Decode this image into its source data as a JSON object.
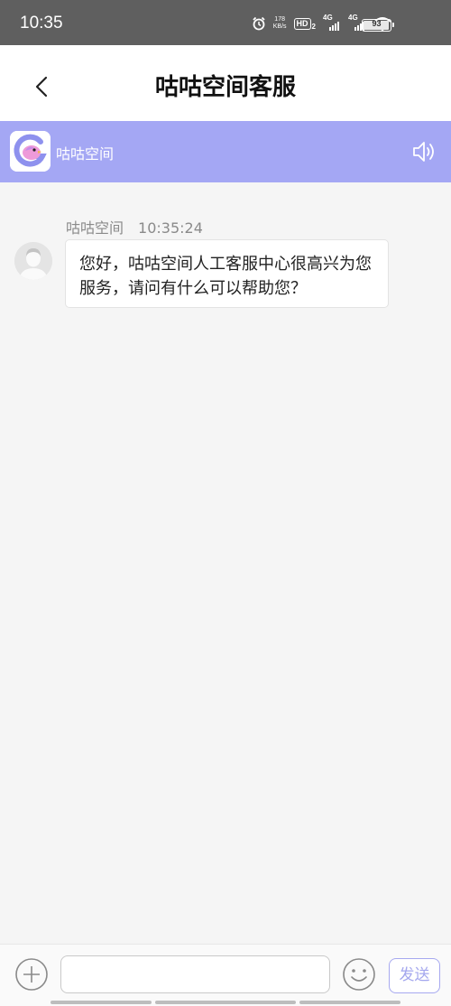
{
  "status_bar": {
    "time": "10:35",
    "net_speed_value": "178",
    "net_speed_unit": "KB/s",
    "hd_label": "HD",
    "hd_sub": "2",
    "signal1_label": "4G",
    "signal2_label": "4G",
    "battery_level": "93",
    "icons": [
      "alarm-icon",
      "hd-voice-icon",
      "signal-4g-icon",
      "signal-4g-icon",
      "wifi-icon",
      "battery-icon"
    ]
  },
  "header": {
    "title": "咕咕空间客服",
    "back_icon": "chevron-left-icon"
  },
  "brand_bar": {
    "name": "咕咕空间",
    "bg_color": "#a4a7f4",
    "speaker_icon": "speaker-icon"
  },
  "messages": [
    {
      "sender": "咕咕空间",
      "time": "10:35:24",
      "text": "您好，咕咕空间人工客服中心很高兴为您服务，请问有什么可以帮助您？"
    }
  ],
  "composer": {
    "input_value": "",
    "input_placeholder": "",
    "send_label": "发送",
    "add_icon": "plus-circle-icon",
    "emoji_icon": "smiley-icon",
    "accent_color": "#a4a7ee"
  }
}
